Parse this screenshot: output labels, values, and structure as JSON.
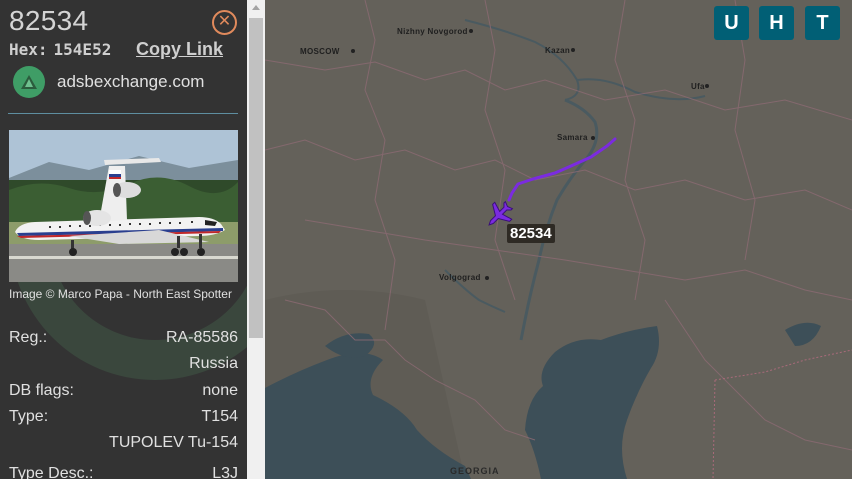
{
  "sidebar": {
    "callsign": "82534",
    "hex_label": "Hex:",
    "hex_value": "154E52",
    "copy_link": "Copy Link",
    "source": "adsbexchange.com",
    "photo_credit": "Image © Marco Papa - North East Spotter",
    "fields": {
      "reg_label": "Reg.:",
      "reg_value": "RA-85586",
      "country": "Russia",
      "dbflags_label": "DB flags:",
      "dbflags_value": "none",
      "type_label": "Type:",
      "type_value": "T154",
      "type_name": "TUPOLEV Tu-154",
      "typedesc_label": "Type Desc.:",
      "typedesc_value": "L3J"
    }
  },
  "map": {
    "aircraft_label": "82534",
    "cities": {
      "moscow": "MOSCOW",
      "nizhny": "Nizhny Novgorod",
      "kazan": "Kazan",
      "ufa": "Ufa",
      "samara": "Samara",
      "volgograd": "Volgograd"
    },
    "regions": {
      "georgia": "GEORGIA"
    },
    "buttons": {
      "u": "U",
      "h": "H",
      "t": "T"
    },
    "track_color": "#7b2be0",
    "button_color": "#015f75"
  }
}
